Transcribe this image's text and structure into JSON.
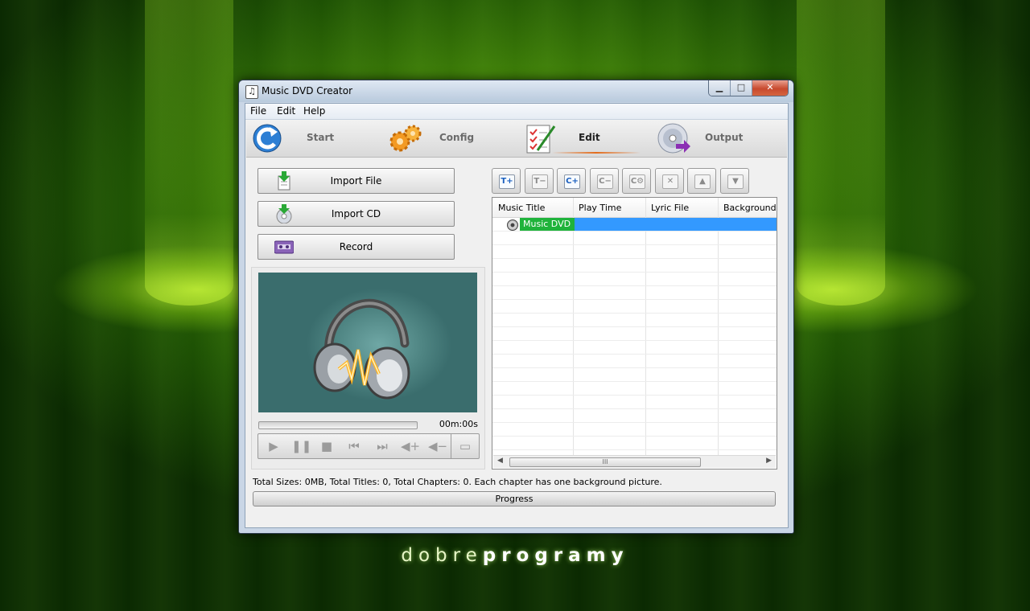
{
  "desktop": {
    "brand_light": "dobre",
    "brand_bold": "programy"
  },
  "window": {
    "title": "Music DVD Creator",
    "controls": {
      "minimize": "▁",
      "maximize": "□",
      "close": "✕"
    }
  },
  "menu": [
    "File",
    "Edit",
    "Help"
  ],
  "steps": [
    {
      "label": "Start",
      "icon": "refresh-icon"
    },
    {
      "label": "Config",
      "icon": "gears-icon"
    },
    {
      "label": "Edit",
      "icon": "edit-checklist-icon",
      "active": true
    },
    {
      "label": "Output",
      "icon": "disc-output-icon"
    }
  ],
  "actions": {
    "import_file": "Import File",
    "import_cd": "Import CD",
    "record": "Record"
  },
  "player": {
    "time": "00m:00s",
    "progress": 0,
    "controls": [
      "play-icon",
      "pause-icon",
      "stop-icon",
      "previous-icon",
      "next-icon",
      "volume-up-icon",
      "volume-down-icon",
      "fullscreen-icon"
    ],
    "glyphs": [
      "▶",
      "❚❚",
      "■",
      "⏮",
      "⏭",
      "◀+",
      "◀−",
      "▭"
    ]
  },
  "toolbar": {
    "buttons": [
      {
        "icon": "add-title-icon",
        "glyph": "T+"
      },
      {
        "icon": "remove-title-icon",
        "glyph": "T−"
      },
      {
        "icon": "add-chapter-icon",
        "glyph": "C+"
      },
      {
        "icon": "remove-chapter-icon",
        "glyph": "C−"
      },
      {
        "icon": "chapter-settings-icon",
        "glyph": "C⚙"
      },
      {
        "icon": "delete-icon",
        "glyph": "✕"
      },
      {
        "icon": "move-up-icon",
        "glyph": "▲"
      },
      {
        "icon": "move-down-icon",
        "glyph": "▼"
      }
    ]
  },
  "table": {
    "columns": [
      "Music Title",
      "Play Time",
      "Lyric File",
      "Background"
    ],
    "rows": [
      {
        "title": "Music DVD",
        "play_time": "",
        "lyric_file": "",
        "background": ""
      }
    ],
    "scroll_grip": "III"
  },
  "status": "Total Sizes: 0MB, Total Titles: 0, Total Chapters: 0. Each chapter has one background picture.",
  "progress": {
    "label": "Progress",
    "value": 0
  },
  "colors": {
    "accent_selection": "#3399ff",
    "title_cell": "#1fb33b",
    "active_underline": "#e36c1c"
  }
}
